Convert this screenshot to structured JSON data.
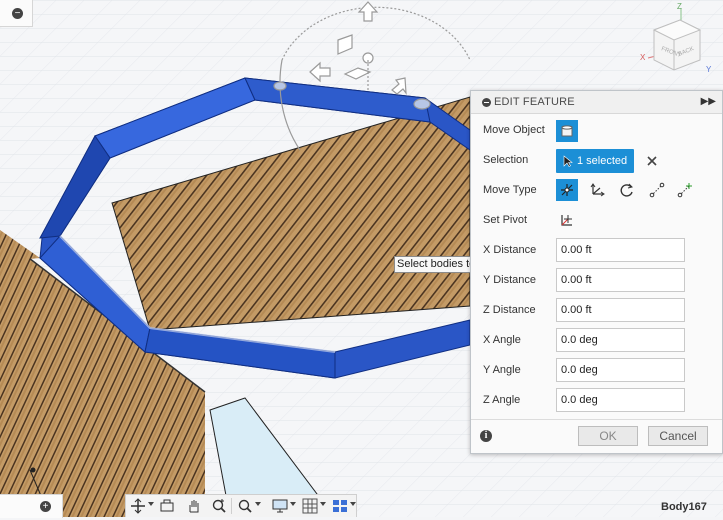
{
  "edit_feature": {
    "title": "EDIT FEATURE",
    "rows": {
      "move_object": "Move Object",
      "selection": "Selection",
      "selection_value": "1 selected",
      "move_type": "Move Type",
      "set_pivot": "Set Pivot",
      "x_distance": "X Distance",
      "x_distance_value": "0.00 ft",
      "y_distance": "Y Distance",
      "y_distance_value": "0.00 ft",
      "z_distance": "Z Distance",
      "z_distance_value": "0.00 ft",
      "x_angle": "X Angle",
      "x_angle_value": "0.0 deg",
      "y_angle": "Y Angle",
      "y_angle_value": "0.0 deg",
      "z_angle": "Z Angle",
      "z_angle_value": "0.0 deg"
    },
    "ok_label": "OK",
    "cancel_label": "Cancel"
  },
  "tooltip": "Select bodies to move",
  "status": {
    "body_name": "Body167"
  },
  "viewcube": {
    "front": "FRONT",
    "back": "BACK",
    "axis_x": "X",
    "axis_y": "Y",
    "axis_z": "Z"
  },
  "colors": {
    "frame_blue": "#2a56c6",
    "wood": "#b98f5d",
    "selection_accent": "#1c8fd6"
  }
}
